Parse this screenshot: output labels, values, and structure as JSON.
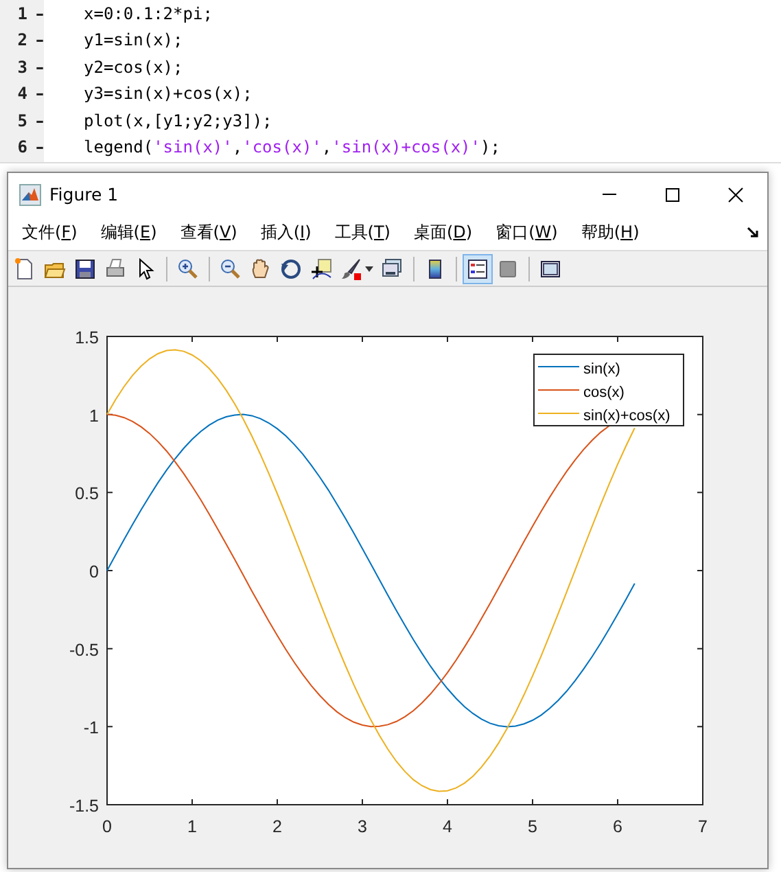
{
  "editor": {
    "lines": [
      {
        "number": "1",
        "marker": "–",
        "tokens": [
          {
            "text": "x=0:0.1:2*pi;",
            "kind": "code"
          }
        ]
      },
      {
        "number": "2",
        "marker": "–",
        "tokens": [
          {
            "text": "y1=sin(x);",
            "kind": "code"
          }
        ]
      },
      {
        "number": "3",
        "marker": "–",
        "tokens": [
          {
            "text": "y2=cos(x);",
            "kind": "code"
          }
        ]
      },
      {
        "number": "4",
        "marker": "–",
        "tokens": [
          {
            "text": "y3=sin(x)+cos(x);",
            "kind": "code"
          }
        ]
      },
      {
        "number": "5",
        "marker": "–",
        "tokens": [
          {
            "text": "plot(x,[y1;y2;y3]);",
            "kind": "code"
          }
        ]
      },
      {
        "number": "6",
        "marker": "–",
        "tokens": [
          {
            "text": "legend(",
            "kind": "code"
          },
          {
            "text": "'sin(x)'",
            "kind": "string"
          },
          {
            "text": ",",
            "kind": "code"
          },
          {
            "text": "'cos(x)'",
            "kind": "string"
          },
          {
            "text": ",",
            "kind": "code"
          },
          {
            "text": "'sin(x)+cos(x)'",
            "kind": "string"
          },
          {
            "text": ");",
            "kind": "code"
          }
        ]
      }
    ]
  },
  "window": {
    "title": "Figure 1"
  },
  "menu": [
    "文件(F)",
    "编辑(E)",
    "查看(V)",
    "插入(I)",
    "工具(T)",
    "桌面(D)",
    "窗口(W)",
    "帮助(H)"
  ],
  "toolbar": [
    {
      "selected": false
    },
    {
      "selected": false
    },
    {
      "selected": false
    },
    {
      "selected": false
    },
    {
      "selected": false
    },
    {
      "selected": false
    },
    {
      "selected": false
    },
    {
      "selected": false
    },
    {
      "selected": false
    },
    {
      "selected": false
    },
    {
      "selected": false
    },
    {
      "selected": false
    },
    {
      "selected": false
    },
    {
      "selected": true
    },
    {
      "selected": false
    },
    {
      "selected": false
    }
  ],
  "chart_data": {
    "type": "line",
    "x": [
      0,
      0.1,
      0.2,
      0.3,
      0.4,
      0.5,
      0.6,
      0.7,
      0.8,
      0.9,
      1,
      1.1,
      1.2,
      1.3,
      1.4,
      1.5,
      1.6,
      1.7,
      1.8,
      1.9,
      2,
      2.1,
      2.2,
      2.3,
      2.4,
      2.5,
      2.6,
      2.7,
      2.8,
      2.9,
      3,
      3.1,
      3.2,
      3.3,
      3.4,
      3.5,
      3.6,
      3.7,
      3.8,
      3.9,
      4,
      4.1,
      4.2,
      4.3,
      4.4,
      4.5,
      4.6,
      4.7,
      4.8,
      4.9,
      5,
      5.1,
      5.2,
      5.3,
      5.4,
      5.5,
      5.6,
      5.7,
      5.8,
      5.9,
      6,
      6.1,
      6.2
    ],
    "series": [
      {
        "name": "sin(x)",
        "color": "#0072bd",
        "values": [
          0,
          0.1,
          0.199,
          0.296,
          0.389,
          0.479,
          0.565,
          0.644,
          0.717,
          0.783,
          0.841,
          0.891,
          0.932,
          0.964,
          0.985,
          0.997,
          1,
          0.992,
          0.974,
          0.946,
          0.909,
          0.863,
          0.808,
          0.746,
          0.675,
          0.598,
          0.516,
          0.427,
          0.335,
          0.239,
          0.141,
          0.042,
          -0.058,
          -0.158,
          -0.256,
          -0.351,
          -0.443,
          -0.53,
          -0.612,
          -0.688,
          -0.757,
          -0.818,
          -0.872,
          -0.916,
          -0.952,
          -0.978,
          -0.994,
          -1,
          -0.996,
          -0.982,
          -0.959,
          -0.926,
          -0.883,
          -0.832,
          -0.773,
          -0.706,
          -0.631,
          -0.551,
          -0.465,
          -0.374,
          -0.279,
          -0.182,
          -0.083
        ]
      },
      {
        "name": "cos(x)",
        "color": "#d95319",
        "values": [
          1,
          0.995,
          0.98,
          0.955,
          0.921,
          0.878,
          0.825,
          0.765,
          0.697,
          0.622,
          0.54,
          0.454,
          0.362,
          0.267,
          0.17,
          0.071,
          -0.029,
          -0.129,
          -0.227,
          -0.323,
          -0.416,
          -0.505,
          -0.589,
          -0.666,
          -0.737,
          -0.801,
          -0.857,
          -0.904,
          -0.942,
          -0.971,
          -0.99,
          -0.999,
          -0.998,
          -0.987,
          -0.967,
          -0.936,
          -0.897,
          -0.848,
          -0.791,
          -0.726,
          -0.654,
          -0.575,
          -0.49,
          -0.401,
          -0.307,
          -0.211,
          -0.112,
          -0.012,
          0.087,
          0.187,
          0.284,
          0.378,
          0.469,
          0.554,
          0.635,
          0.709,
          0.776,
          0.835,
          0.886,
          0.927,
          null,
          null,
          null
        ]
      },
      {
        "name": "sin(x)+cos(x)",
        "color": "#edb120",
        "values": [
          1,
          1.095,
          1.179,
          1.251,
          1.31,
          1.357,
          1.39,
          1.409,
          1.414,
          1.405,
          1.381,
          1.345,
          1.294,
          1.231,
          1.155,
          1.068,
          0.971,
          0.863,
          0.747,
          0.623,
          0.493,
          0.358,
          0.219,
          0.08,
          -0.062,
          -0.203,
          -0.341,
          -0.477,
          -0.607,
          -0.732,
          -0.849,
          -0.957,
          -1.056,
          -1.145,
          -1.223,
          -1.287,
          -1.34,
          -1.378,
          -1.403,
          -1.414,
          -1.411,
          -1.393,
          -1.362,
          -1.317,
          -1.259,
          -1.189,
          -1.106,
          -1.012,
          -0.909,
          -0.795,
          -0.675,
          -0.548,
          -0.414,
          -0.278,
          -0.138,
          0.003,
          0.145,
          0.284,
          0.421,
          0.553,
          0.681,
          0.801,
          0.914
        ]
      }
    ],
    "xlim": [
      0,
      7
    ],
    "ylim": [
      -1.5,
      1.5
    ],
    "xticks": [
      {
        "value": 0,
        "label": "0"
      },
      {
        "value": 1,
        "label": "1"
      },
      {
        "value": 2,
        "label": "2"
      },
      {
        "value": 3,
        "label": "3"
      },
      {
        "value": 4,
        "label": "4"
      },
      {
        "value": 5,
        "label": "5"
      },
      {
        "value": 6,
        "label": "6"
      },
      {
        "value": 7,
        "label": "7"
      }
    ],
    "yticks": [
      {
        "value": -1.5,
        "label": "-1.5"
      },
      {
        "value": -1,
        "label": "-1"
      },
      {
        "value": -0.5,
        "label": "-0.5"
      },
      {
        "value": 0,
        "label": "0"
      },
      {
        "value": 0.5,
        "label": "0.5"
      },
      {
        "value": 1,
        "label": "1"
      },
      {
        "value": 1.5,
        "label": "1.5"
      }
    ],
    "legend": true
  }
}
